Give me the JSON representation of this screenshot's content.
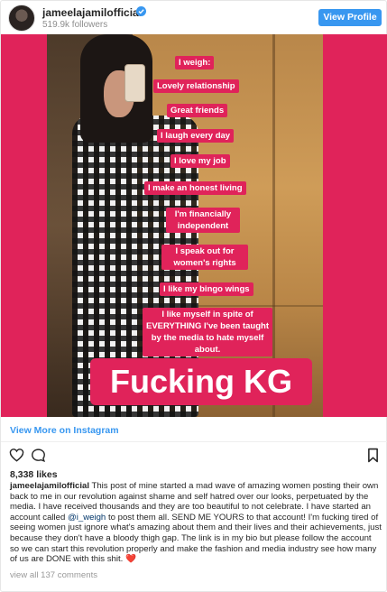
{
  "header": {
    "username": "jameelajamilofficial",
    "followers": "519.9k followers",
    "view_profile_label": "View Profile",
    "accent": "#3897f0"
  },
  "image": {
    "background": "#e0235a",
    "tags": [
      "I weigh:",
      "Lovely relationship",
      "Great friends",
      "I laugh every day",
      "I love my job",
      "I make an honest living",
      "I'm financially independent",
      "I speak out for women's rights",
      "I like my bingo wings",
      "I like myself in spite of EVERYTHING I've been taught by the media to hate myself about."
    ],
    "big_text": "Fucking KG"
  },
  "view_more_label": "View More on Instagram",
  "actions": {
    "like_icon": "heart-outline-icon",
    "comment_icon": "comment-bubble-icon",
    "save_icon": "bookmark-outline-icon"
  },
  "likes": "8,338 likes",
  "caption": {
    "author": "jameelajamilofficial",
    "text_before": " This post of mine started a mad wave of amazing women posting their own back to me in our revolution against shame and self hatred over our looks, perpetuated by the media. I have received thousands and they are too beautiful to not celebrate. I have started an account called ",
    "mention": "@i_weigh",
    "text_after": " to post them all. SEND ME YOURS to that account! I'm fucking tired of seeing women just ignore what's amazing about them and their lives and their achievements, just because they don't have a bloody thigh gap. The link is in my bio but please follow the account so we can start this revolution properly and make the fashion and media industry see how many of us are DONE with this shit. ",
    "emoji": "❤️"
  },
  "comments_link": "view all 137 comments"
}
